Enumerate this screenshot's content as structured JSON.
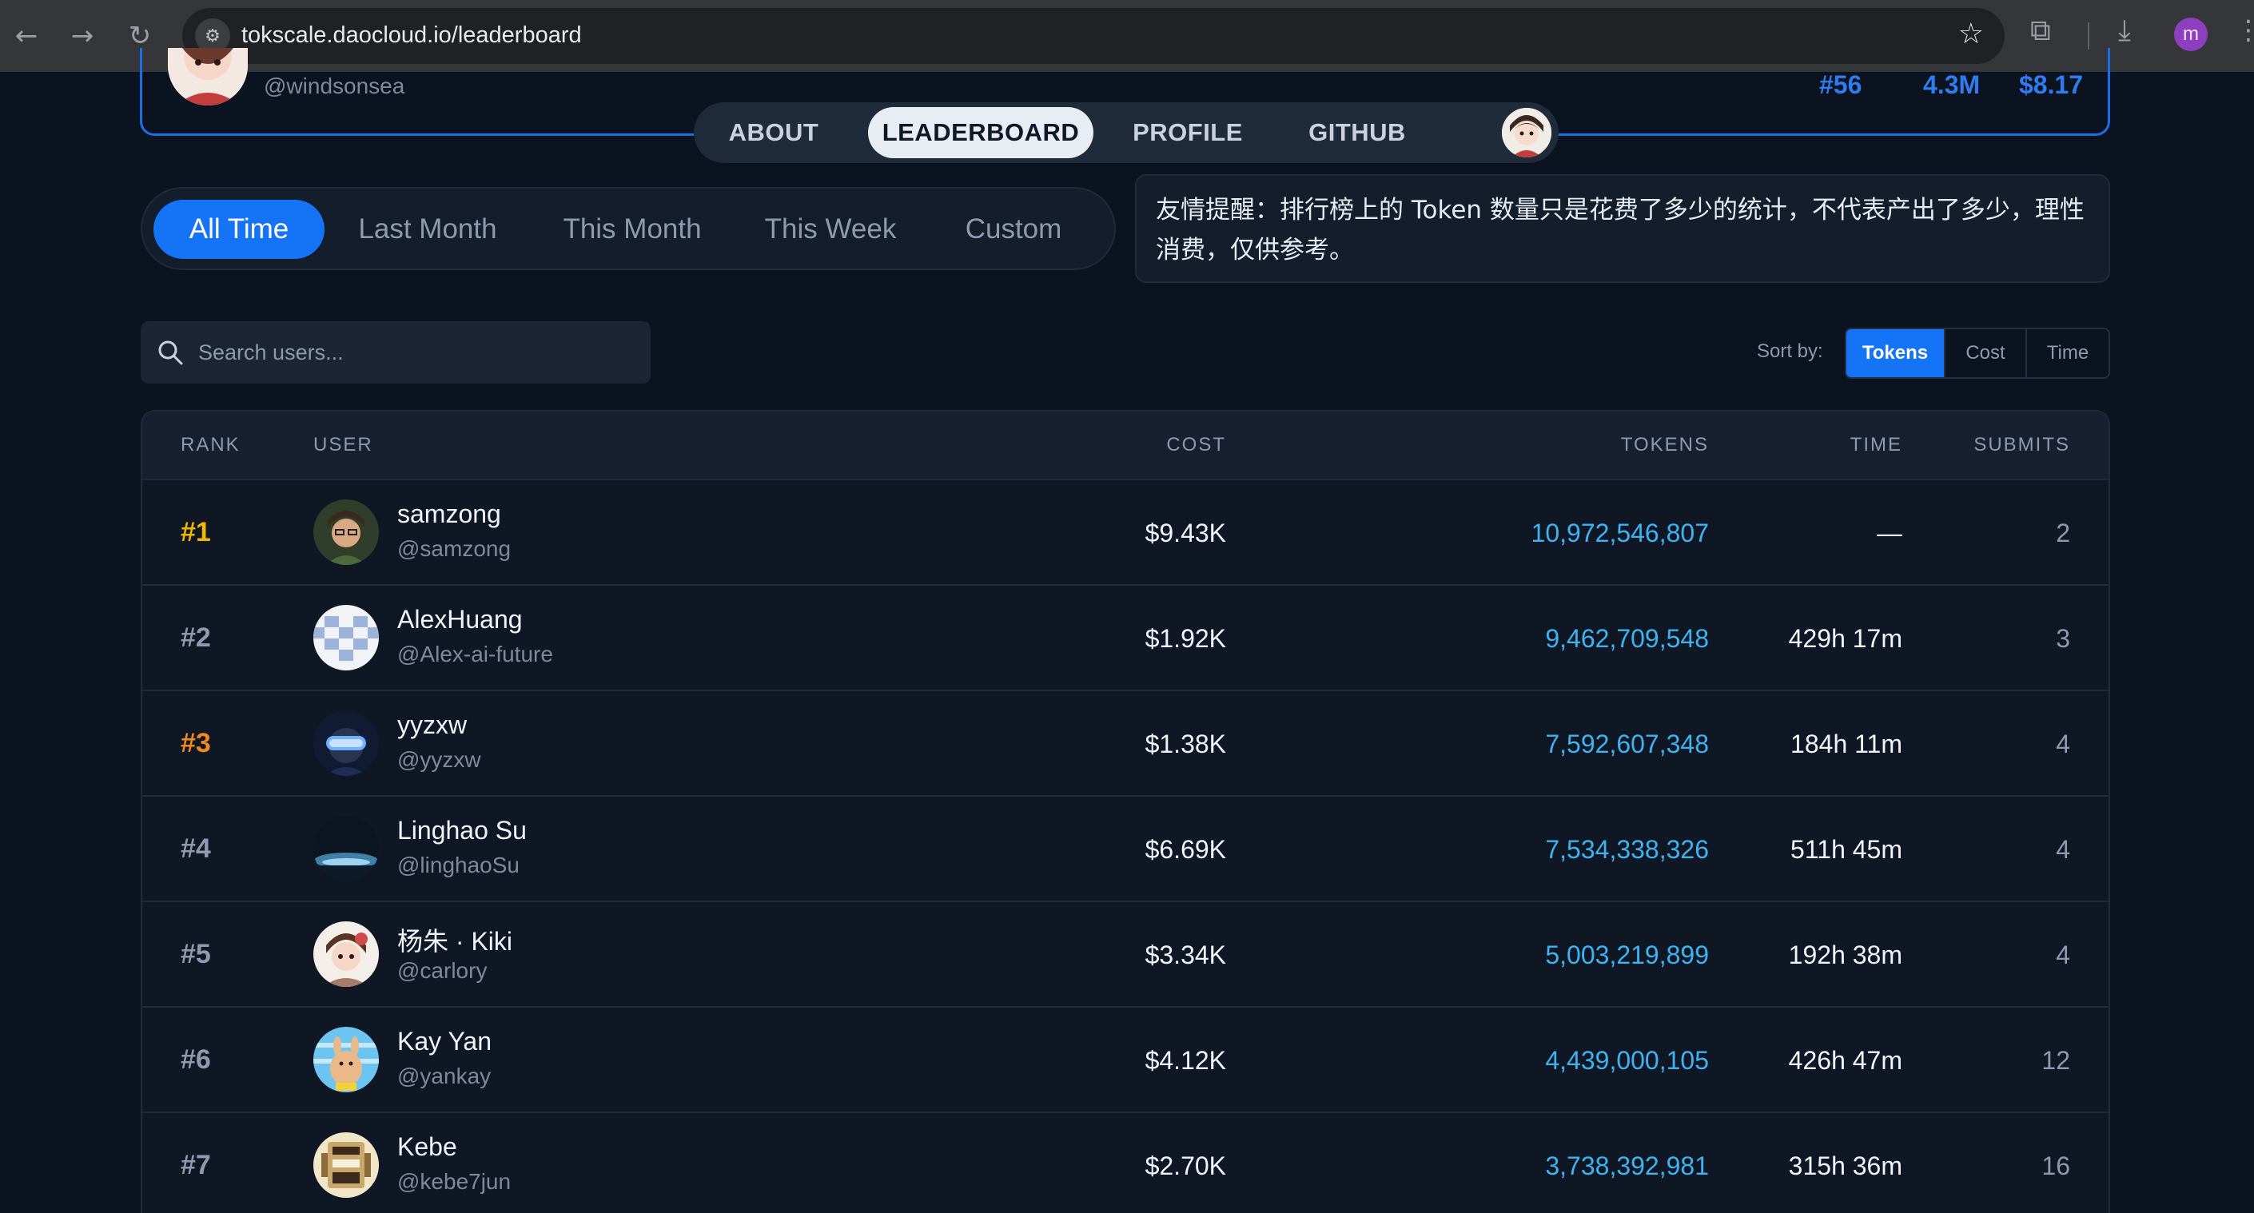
{
  "browser": {
    "url": "tokscale.daocloud.io/leaderboard",
    "profile_initial": "m"
  },
  "current_user": {
    "handle": "@windsonsea",
    "rank": "#56",
    "tokens": "4.3M",
    "cost": "$8.17"
  },
  "main_nav": {
    "tabs": [
      {
        "label": "ABOUT"
      },
      {
        "label": "LEADERBOARD"
      },
      {
        "label": "PROFILE"
      },
      {
        "label": "GITHUB"
      }
    ],
    "active": "LEADERBOARD"
  },
  "period": {
    "tabs": [
      {
        "label": "All Time"
      },
      {
        "label": "Last Month"
      },
      {
        "label": "This Month"
      },
      {
        "label": "This Week"
      },
      {
        "label": "Custom"
      }
    ],
    "active": "All Time"
  },
  "notice": {
    "text": "友情提醒：排行榜上的 Token 数量只是花费了多少的统计，不代表产出了多少，理性消费，仅供参考。"
  },
  "search": {
    "placeholder": "Search users..."
  },
  "sort": {
    "label": "Sort by:",
    "options": [
      {
        "label": "Tokens"
      },
      {
        "label": "Cost"
      },
      {
        "label": "Time"
      }
    ],
    "active": "Tokens"
  },
  "table": {
    "headers": {
      "rank": "RANK",
      "user": "USER",
      "cost": "COST",
      "tokens": "TOKENS",
      "time": "TIME",
      "submits": "SUBMITS"
    },
    "rows": [
      {
        "rank": "#1",
        "name": "samzong",
        "handle": "@samzong",
        "cost": "$9.43K",
        "tokens": "10,972,546,807",
        "time": "—",
        "submits": "2"
      },
      {
        "rank": "#2",
        "name": "AlexHuang",
        "handle": "@Alex-ai-future",
        "cost": "$1.92K",
        "tokens": "9,462,709,548",
        "time": "429h 17m",
        "submits": "3"
      },
      {
        "rank": "#3",
        "name": "yyzxw",
        "handle": "@yyzxw",
        "cost": "$1.38K",
        "tokens": "7,592,607,348",
        "time": "184h 11m",
        "submits": "4"
      },
      {
        "rank": "#4",
        "name": "Linghao Su",
        "handle": "@linghaoSu",
        "cost": "$6.69K",
        "tokens": "7,534,338,326",
        "time": "511h 45m",
        "submits": "4"
      },
      {
        "rank": "#5",
        "name": "杨朱 · Kiki",
        "handle": "@carlory",
        "cost": "$3.34K",
        "tokens": "5,003,219,899",
        "time": "192h 38m",
        "submits": "4"
      },
      {
        "rank": "#6",
        "name": "Kay Yan",
        "handle": "@yankay",
        "cost": "$4.12K",
        "tokens": "4,439,000,105",
        "time": "426h 47m",
        "submits": "12"
      },
      {
        "rank": "#7",
        "name": "Kebe",
        "handle": "@kebe7jun",
        "cost": "$2.70K",
        "tokens": "3,738,392,981",
        "time": "315h 36m",
        "submits": "16"
      }
    ]
  },
  "colors": {
    "accent": "#1573f5",
    "tokens": "#3fb3f0",
    "rank_gold": "#f2b705",
    "rank_bronze": "#f08a1c"
  }
}
